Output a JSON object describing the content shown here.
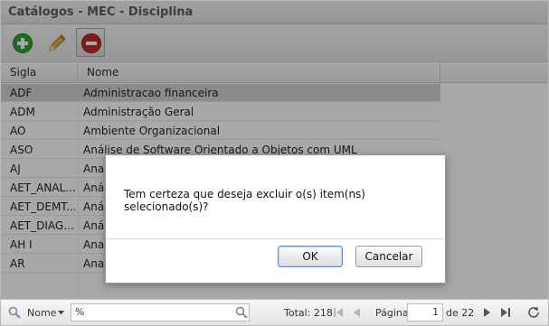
{
  "window": {
    "title": "Catálogos - MEC - Disciplina"
  },
  "toolbar": {
    "buttons": [
      "plus-circle-icon",
      "pencil-icon",
      "minus-circle-icon"
    ]
  },
  "grid": {
    "columns": [
      "Sigla",
      "Nome"
    ],
    "rows": [
      {
        "sigla": "ADF",
        "nome": "Administracao financeira"
      },
      {
        "sigla": "ADM",
        "nome": "Administração Geral"
      },
      {
        "sigla": "AO",
        "nome": "Ambiente Organizacional"
      },
      {
        "sigla": "ASO",
        "nome": "Análise de Software Orientado a Objetos com UML"
      },
      {
        "sigla": "AJ",
        "nome": "Ana"
      },
      {
        "sigla": "AET_ANAL...",
        "nome": "Aná"
      },
      {
        "sigla": "AET_DEMT...",
        "nome": "Aná"
      },
      {
        "sigla": "AET_DIAG...",
        "nome": "Aná"
      },
      {
        "sigla": "AH I",
        "nome": "Ana"
      },
      {
        "sigla": "AR",
        "nome": "Ana"
      }
    ]
  },
  "dialog": {
    "message": "Tem certeza que deseja excluir o(s) item(ns) selecionado(s)?",
    "ok_label": "OK",
    "cancel_label": "Cancelar"
  },
  "pager": {
    "search_field": "Nome",
    "search_value": "%",
    "total_label": "Total: 218",
    "page_label": "Página",
    "page_value": "1",
    "of_label": "de 22"
  },
  "colors": {
    "selected_row": "#d4d4d4",
    "add": "#2fa82f",
    "delete": "#c92a2a",
    "pencil": "#e0b040"
  }
}
